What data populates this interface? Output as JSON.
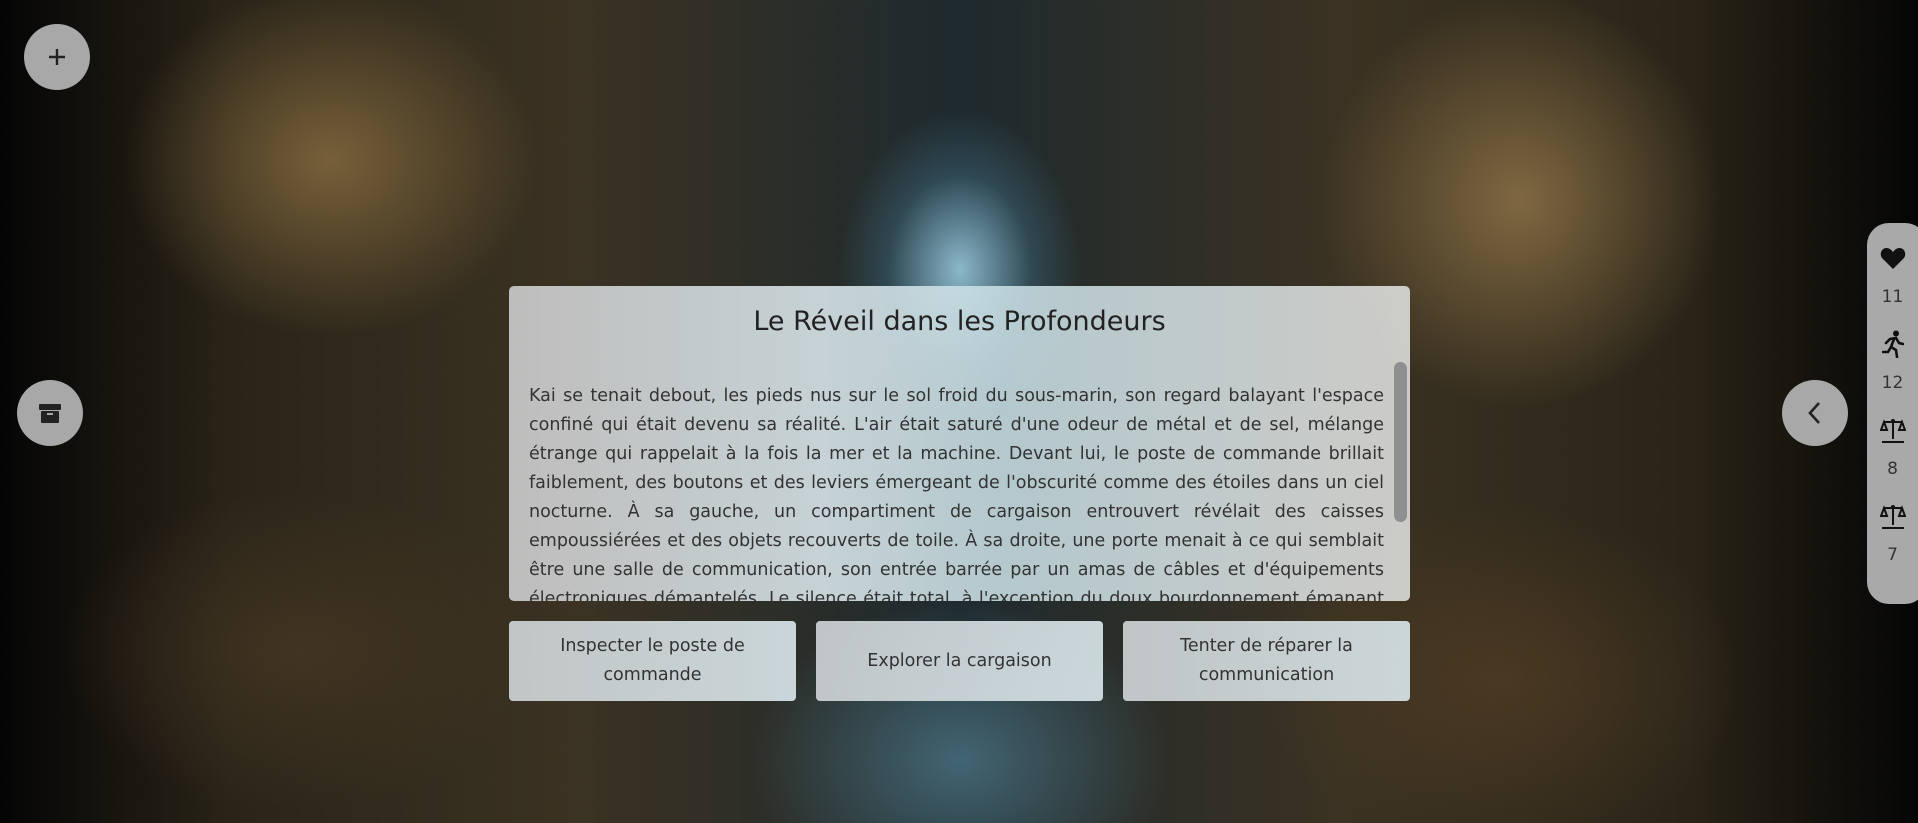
{
  "story": {
    "title": "Le Réveil dans les Profondeurs",
    "text": "Kai se tenait debout, les pieds nus sur le sol froid du sous-marin, son regard balayant l'espace confiné qui était devenu sa réalité. L'air était saturé d'une odeur de métal et de sel, mélange étrange qui rappelait à la fois la mer et la machine. Devant lui, le poste de commande brillait faiblement, des boutons et des leviers émergeant de l'obscurité comme des étoiles dans un ciel nocturne. À sa gauche, un compartiment de cargaison entrouvert révélait des caisses empoussiérées et des objets recouverts de toile. À sa droite, une porte menait à ce qui semblait être une salle de communication, son entrée barrée par un amas de câbles et d'équipements électroniques démantelés. Le silence était total, à l'exception du doux bourdonnement émanant du"
  },
  "choices": [
    {
      "label": "Inspecter le poste de commande"
    },
    {
      "label": "Explorer la cargaison"
    },
    {
      "label": "Tenter de réparer la communication"
    }
  ],
  "stats": [
    {
      "icon": "heart-icon",
      "value": "11"
    },
    {
      "icon": "running-icon",
      "value": "12"
    },
    {
      "icon": "scales-icon",
      "value": "8"
    },
    {
      "icon": "scales-icon",
      "value": "7"
    }
  ]
}
